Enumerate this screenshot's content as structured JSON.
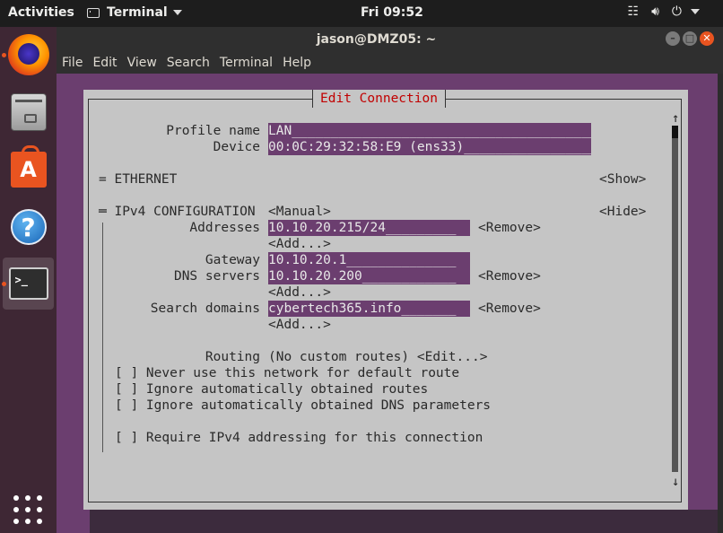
{
  "topbar": {
    "activities": "Activities",
    "app_menu": "Terminal",
    "clock": "Fri 09:52",
    "tray_icons": [
      "network-icon",
      "volume-icon",
      "power-icon",
      "chevron-down-icon"
    ]
  },
  "dock": {
    "items": [
      "firefox",
      "files",
      "software",
      "help",
      "terminal"
    ],
    "active": "terminal"
  },
  "window": {
    "title": "jason@DMZ05: ~",
    "menu": [
      "File",
      "Edit",
      "View",
      "Search",
      "Terminal",
      "Help"
    ]
  },
  "dialog": {
    "title": "Edit Connection",
    "profile_name_label": "Profile name",
    "profile_name_value": "LAN_______________________________________",
    "device_label": "Device",
    "device_value": "00:0C:29:32:58:E9 (ens33)_________________",
    "ethernet_label": "= ETHERNET",
    "ethernet_toggle": "<Show>",
    "ipv4_label": "═ IPv4 CONFIGURATION",
    "ipv4_mode": "<Manual>",
    "ipv4_toggle": "<Hide>",
    "addresses_label": "Addresses",
    "addresses_value": "10.10.20.215/24_________",
    "remove": "<Remove>",
    "add": "<Add...>",
    "gateway_label": "Gateway",
    "gateway_value": "10.10.20.1______________",
    "dns_label": "DNS servers",
    "dns_value": "10.10.20.200____________",
    "search_label": "Search domains",
    "search_value": "cybertech365.info_______",
    "routing_label": "Routing",
    "routing_value": "(No custom routes) <Edit...>",
    "never_default": "[ ] Never use this network for default route",
    "ignore_routes": "[ ] Ignore automatically obtained routes",
    "ignore_dns": "[ ] Ignore automatically obtained DNS parameters",
    "require_ipv4": "[ ] Require IPv4 addressing for this connection"
  }
}
